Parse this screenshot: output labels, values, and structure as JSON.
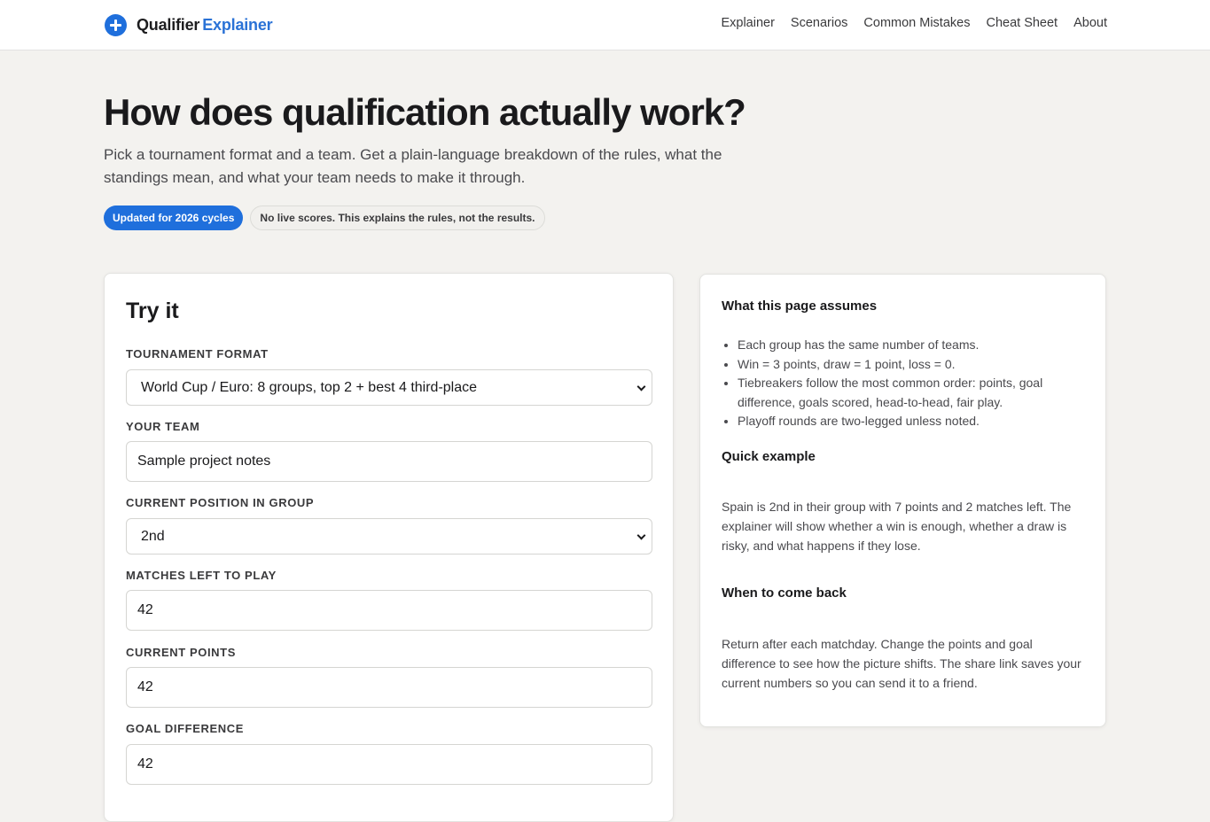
{
  "brand": {
    "name_part1": "Qualifier",
    "name_part2": "Explainer",
    "logo_icon": "plus-circle-icon"
  },
  "nav": {
    "items": [
      {
        "label": "Explainer"
      },
      {
        "label": "Scenarios"
      },
      {
        "label": "Common Mistakes"
      },
      {
        "label": "Cheat Sheet"
      },
      {
        "label": "About"
      }
    ]
  },
  "hero": {
    "title": "How does qualification actually work?",
    "subtitle": "Pick a tournament format and a team. Get a plain-language breakdown of the rules, what the standings mean, and what your team needs to make it through.",
    "badges": [
      {
        "label": "Updated for 2026 cycles"
      },
      {
        "label": "No live scores. This explains the rules, not the results."
      }
    ]
  },
  "form": {
    "title": "Try it",
    "tournament_format": {
      "label": "TOURNAMENT FORMAT",
      "value": "World Cup / Euro: 8 groups, top 2 + best 4 third-place"
    },
    "your_team": {
      "label": "YOUR TEAM",
      "value": "Sample project notes"
    },
    "position": {
      "label": "CURRENT POSITION IN GROUP",
      "value": "2nd"
    },
    "matches_left": {
      "label": "MATCHES LEFT TO PLAY",
      "value": "42"
    },
    "points": {
      "label": "CURRENT POINTS",
      "value": "42"
    },
    "goal_difference": {
      "label": "GOAL DIFFERENCE",
      "value": "42"
    }
  },
  "assumptions": {
    "title": "What this page assumes",
    "items": [
      "Each group has the same number of teams.",
      "Win = 3 points, draw = 1 point, loss = 0.",
      "Tiebreakers follow the most common order: points, goal difference, goals scored, head-to-head, fair play.",
      "Playoff rounds are two-legged unless noted."
    ],
    "example_title": "Quick example",
    "example_text": "Spain is 2nd in their group with 7 points and 2 matches left. The explainer will show whether a win is enough, whether a draw is risky, and what happens if they lose.",
    "comeback_title": "When to come back",
    "comeback_text": "Return after each matchday. Change the points and goal difference to see how the picture shifts. The share link saves your current numbers so you can send it to a friend."
  },
  "colors": {
    "accent": "#1f6fdc",
    "page_bg": "#f3f2ef"
  }
}
